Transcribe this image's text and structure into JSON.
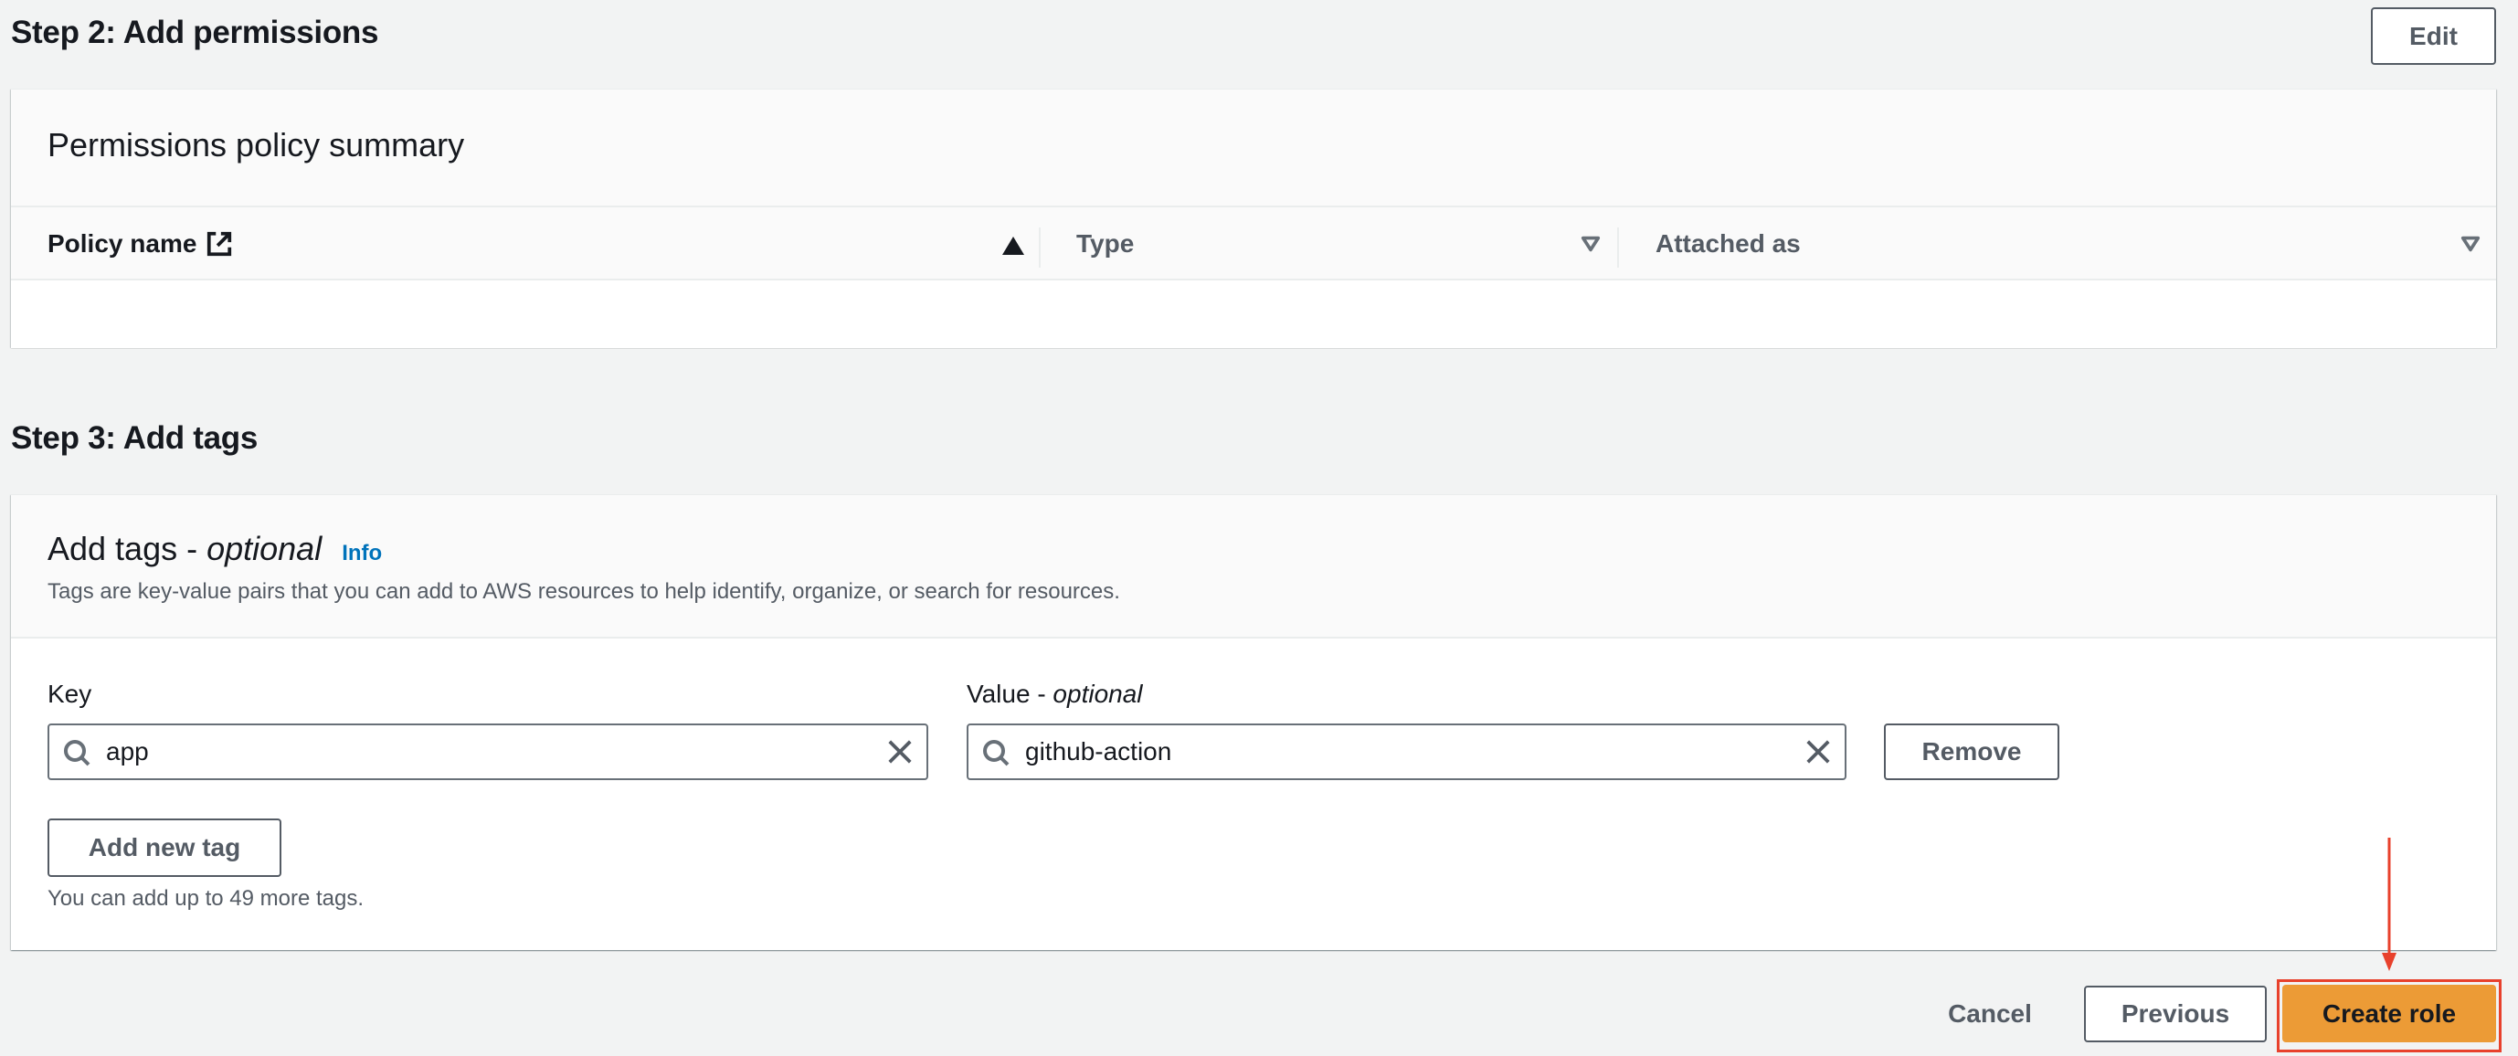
{
  "step2": {
    "title": "Step 2: Add permissions",
    "edit_label": "Edit",
    "card_title": "Permissions policy summary",
    "columns": [
      {
        "label": "Policy name",
        "icon": "external-link-icon",
        "sort": "ascending"
      },
      {
        "label": "Type",
        "sort": "none"
      },
      {
        "label": "Attached as",
        "sort": "none"
      }
    ],
    "rows": []
  },
  "step3": {
    "title": "Step 3: Add tags",
    "card_title": "Add tags - ",
    "card_title_optional": "optional",
    "info_label": "Info",
    "description": "Tags are key-value pairs that you can add to AWS resources to help identify, organize, or search for resources.",
    "tags": [
      {
        "key_label": "Key",
        "key_value": "app",
        "value_label": "Value - ",
        "value_label_optional": "optional",
        "value_value": "github-action",
        "remove_label": "Remove"
      }
    ],
    "add_tag_label": "Add new tag",
    "remaining_hint": "You can add up to 49 more tags."
  },
  "footer": {
    "cancel_label": "Cancel",
    "previous_label": "Previous",
    "create_label": "Create role"
  },
  "colors": {
    "primary": "#ec9b36",
    "link": "#0073bb",
    "annotation": "#e8412c"
  }
}
